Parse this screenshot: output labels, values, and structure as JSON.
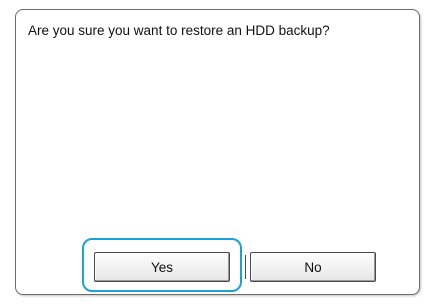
{
  "dialog": {
    "message": "Are you sure you want to restore an HDD backup?",
    "buttons": {
      "yes_label": "Yes",
      "no_label": "No"
    },
    "focused_button": "Yes",
    "colors": {
      "focus_ring": "#1aa3d6",
      "border": "#6e6e6e",
      "background": "#ffffff"
    }
  }
}
